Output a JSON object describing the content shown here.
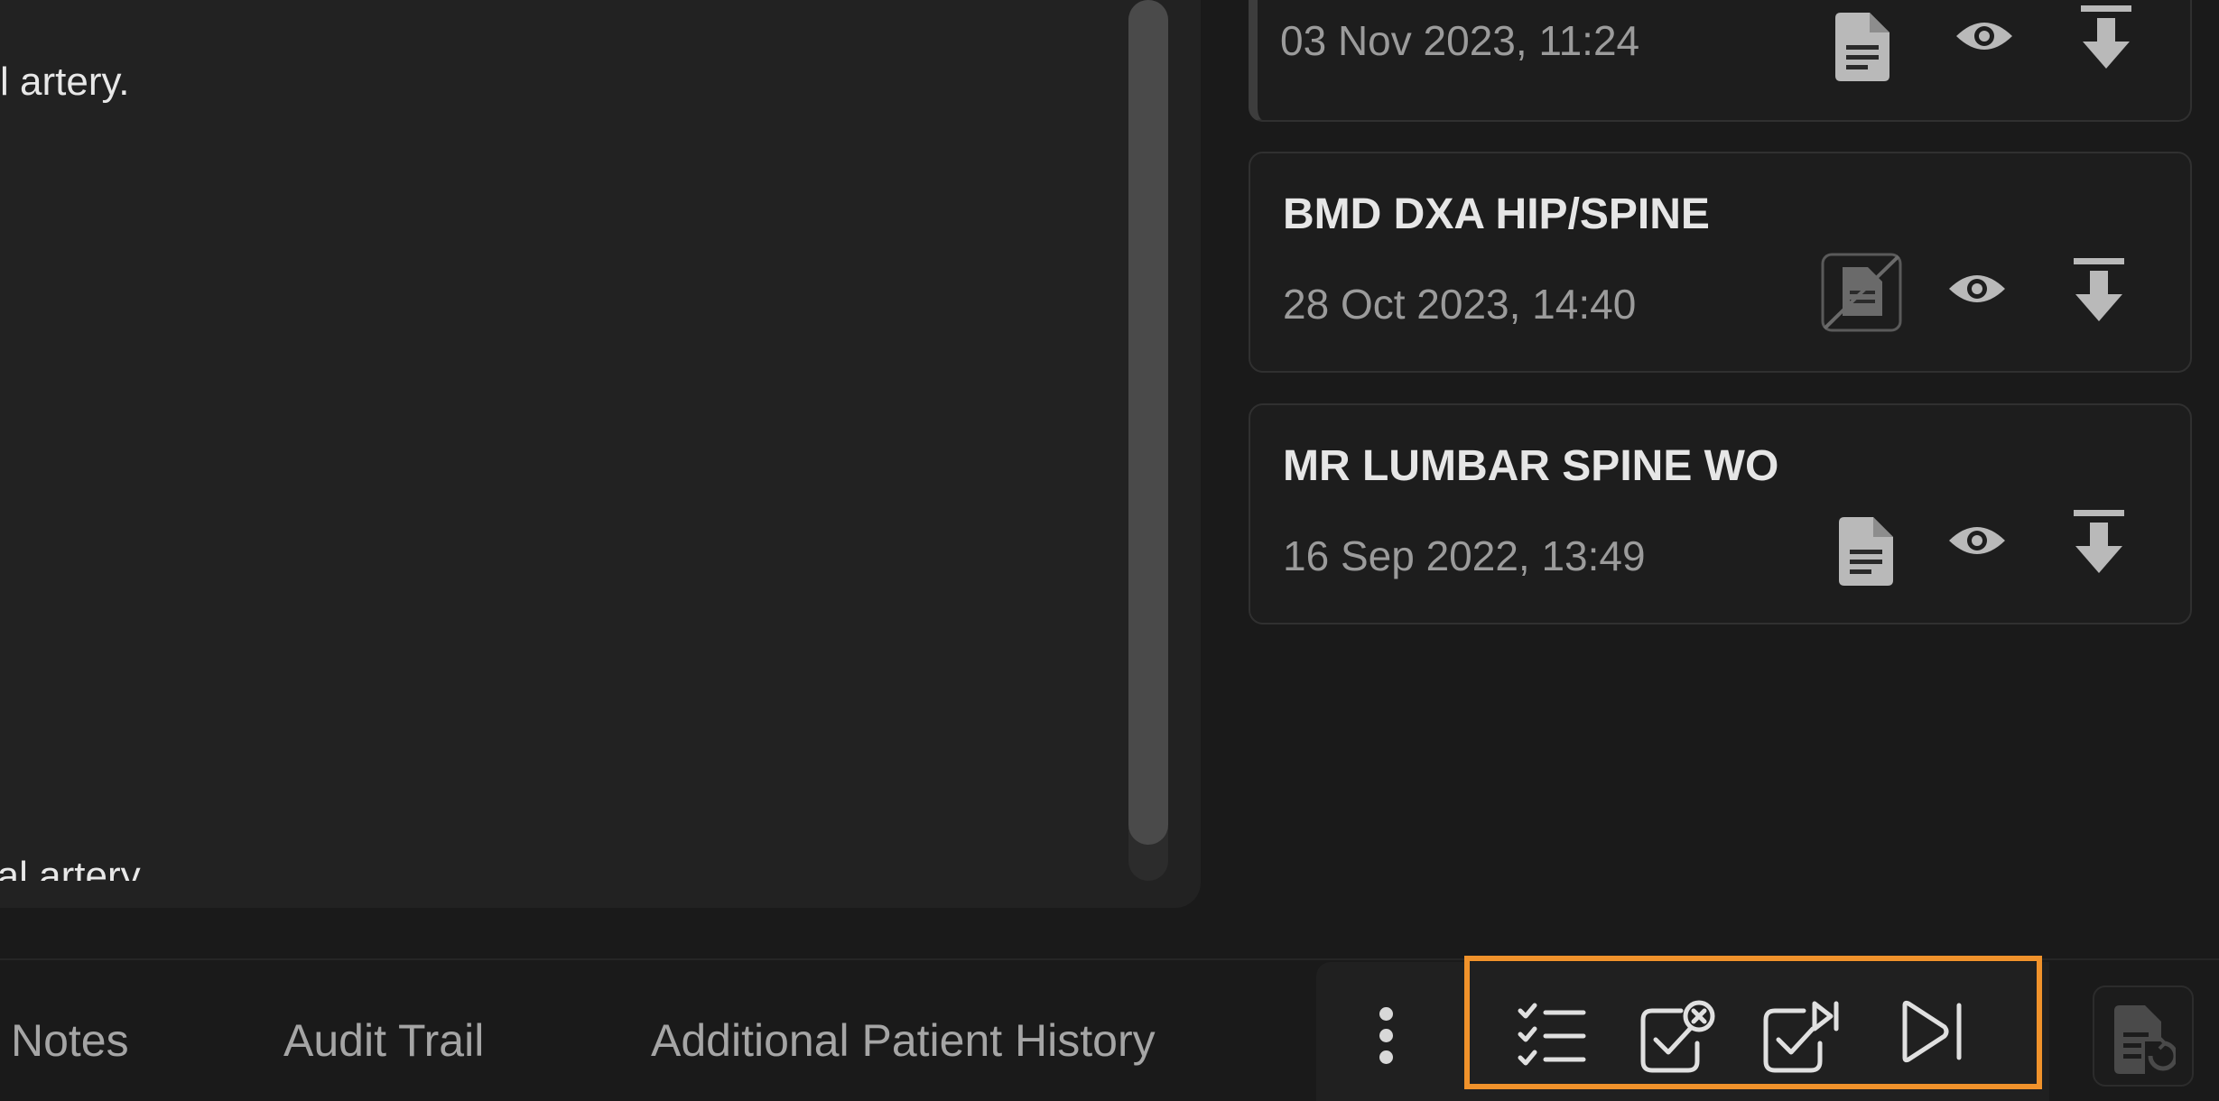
{
  "report": {
    "line_1": "l artery.",
    "line_2": "ral artery"
  },
  "studies": [
    {
      "name": "",
      "date": "03 Nov 2023, 11:24",
      "status": "report-available"
    },
    {
      "name": "BMD DXA HIP/SPINE",
      "date": "28 Oct 2023, 14:40",
      "status": "no-report"
    },
    {
      "name": "MR LUMBAR SPINE WO",
      "date": "16 Sep 2022, 13:49",
      "status": "report-available"
    }
  ],
  "tabs": {
    "notes": "Notes",
    "audit_trail": "Audit Trail",
    "additional_history": "Additional Patient History"
  },
  "actions": {
    "icons": [
      "more-vertical-icon",
      "checklist-icon",
      "check-cancel-icon",
      "check-next-icon",
      "skip-next-icon",
      "document-history-icon"
    ]
  },
  "colors": {
    "accent_highlight": "#f0922b",
    "icon_gray": "#b9b9b9",
    "text_muted": "#9b9b9b"
  }
}
